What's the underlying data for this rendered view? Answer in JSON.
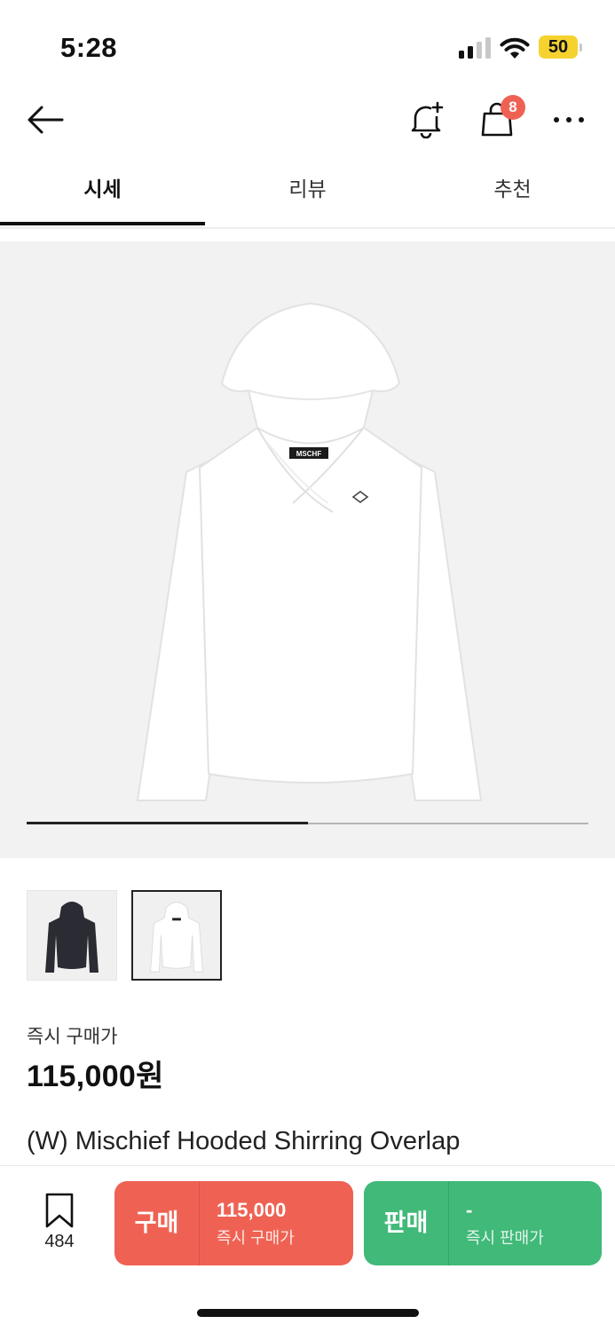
{
  "status_bar": {
    "time": "5:28",
    "battery": "50",
    "battery_color": "#f5d22e"
  },
  "nav": {
    "cart_badge": "8"
  },
  "tabs": [
    {
      "label": "시세",
      "active": true
    },
    {
      "label": "리뷰",
      "active": false
    },
    {
      "label": "추천",
      "active": false
    }
  ],
  "gallery": {
    "current_page_fraction": 0.5,
    "thumbnails": [
      "black",
      "white"
    ],
    "selected_thumbnail": 1
  },
  "price": {
    "label": "즉시 구매가",
    "value": "115,000원"
  },
  "product": {
    "name": "(W) Mischief Hooded Shirring Overlap"
  },
  "bottom_bar": {
    "wish_count": "484",
    "buy": {
      "label": "구매",
      "price": "115,000",
      "sub": "즉시 구매가",
      "color": "#ef6253"
    },
    "sell": {
      "label": "판매",
      "price": "-",
      "sub": "즉시 판매가",
      "color": "#41b979"
    }
  }
}
